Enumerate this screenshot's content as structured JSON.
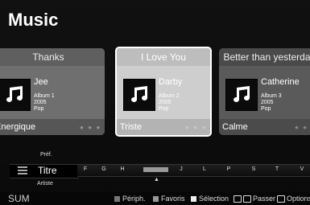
{
  "app": {
    "title": "Music"
  },
  "cards": [
    {
      "title": "Thanks",
      "artist": "Jee",
      "album": "Album 1",
      "year": "2005",
      "genre": "Pop",
      "mood": "Energique",
      "rating": "★ ★ ★"
    },
    {
      "title": "I Love You",
      "artist": "Darby",
      "album": "Album 2",
      "year": "2005",
      "genre": "Pop",
      "mood": "Triste",
      "rating": "★ ★ ★"
    },
    {
      "title": "Better than yesterday",
      "artist": "Catherine",
      "album": "Album 3",
      "year": "2005",
      "genre": "Pop",
      "mood": "Calme",
      "rating": "★ ★ ★"
    }
  ],
  "sort": {
    "prev": "Préf.",
    "current": "Titre",
    "next": "Artiste"
  },
  "index": {
    "letters": [
      "F",
      "G",
      "H",
      "J",
      "L",
      "P",
      "S",
      "T",
      "V"
    ]
  },
  "bottom": {
    "brand": "SUM",
    "hints": {
      "periph": "Périph.",
      "favoris": "Favoris",
      "selection": "Sélection",
      "passer": "Passer",
      "options": "Options"
    }
  },
  "colors": {
    "selected_card": "#c2c2c2",
    "background": "#0a0a0a"
  }
}
